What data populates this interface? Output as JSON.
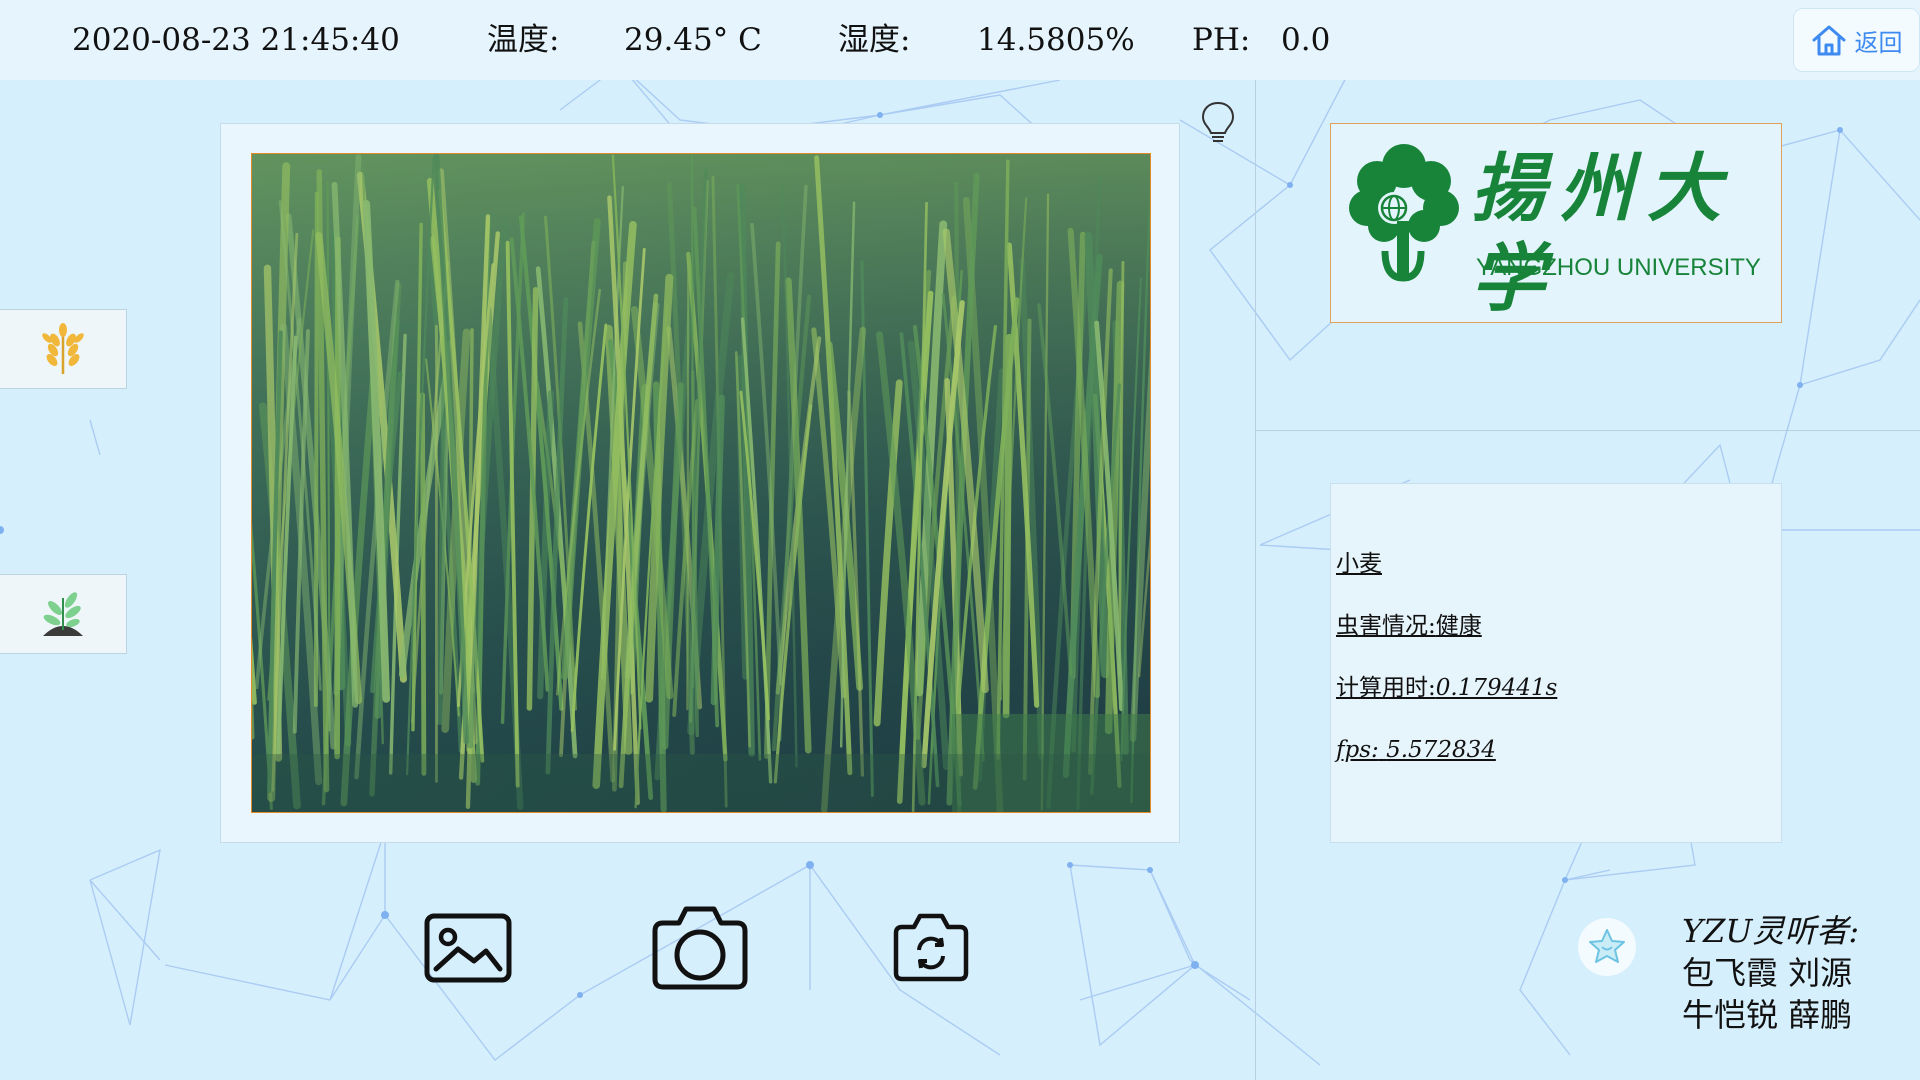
{
  "status_bar": {
    "datetime": "2020-08-23 21:45:40",
    "temperature_label": "温度:",
    "temperature_value": "29.45° C",
    "humidity_label": "湿度:",
    "humidity_value": "14.5805%",
    "ph_label": "PH:",
    "ph_value": "0.0"
  },
  "nav": {
    "return_label": "返回",
    "return_icon": "home-icon"
  },
  "sidebar": {
    "items": [
      {
        "icon": "wheat-icon"
      },
      {
        "icon": "seedling-icon"
      }
    ]
  },
  "logo": {
    "name_cn": "揚州大学",
    "name_en": "YANGZHOU UNIVERSITY"
  },
  "result": {
    "crop": "小麦",
    "pest_label": "虫害情况:",
    "pest_value": "健康",
    "time_label": "计算用时:",
    "time_value": "0.179441s",
    "fps_label": "fps:",
    "fps_value": "5.572834"
  },
  "toolbar": {
    "buttons": [
      {
        "icon": "image-icon"
      },
      {
        "icon": "camera-icon"
      },
      {
        "icon": "camera-switch-icon"
      }
    ]
  },
  "credits": {
    "line1": "YZU灵听者:",
    "line2": "包飞霞 刘源",
    "line3": "牛恺锐 薛鹏"
  },
  "colors": {
    "background": "#d6effc",
    "accent": "#3d8af0",
    "logo_green": "#18843a",
    "frame_orange": "#e58a2a"
  }
}
